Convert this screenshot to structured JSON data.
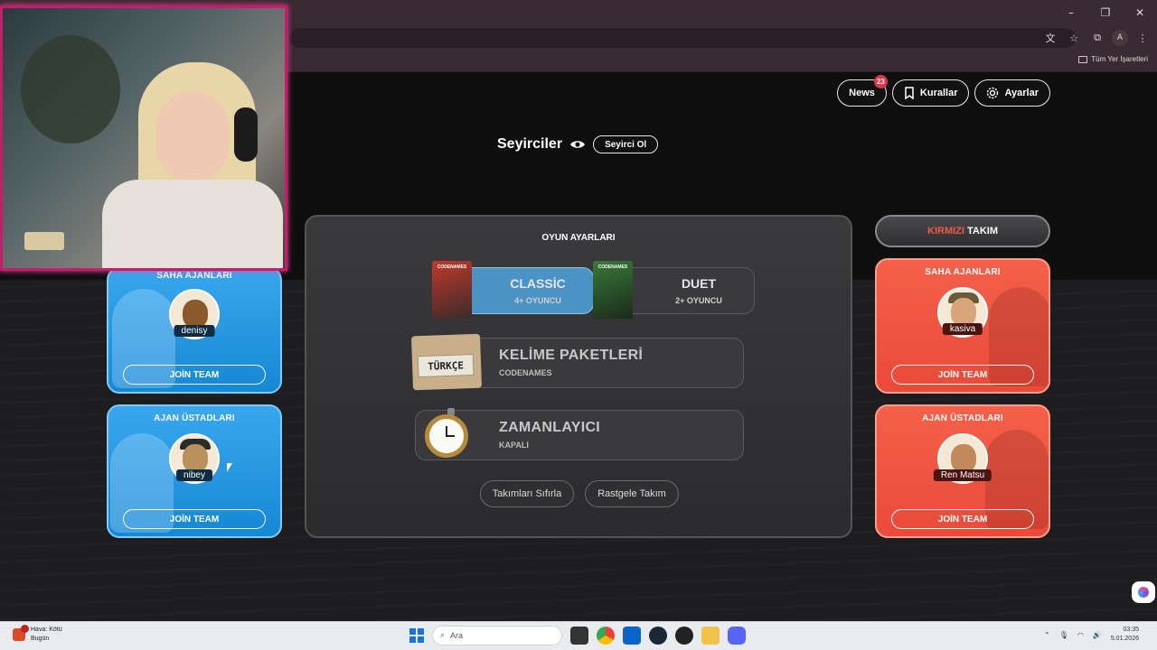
{
  "browser": {
    "window_controls": [
      "–",
      "❐",
      "✕"
    ],
    "profile_initial": "A",
    "bookmarks_all_label": "Tüm Yer İşaretleri"
  },
  "nav": {
    "news_label": "News",
    "news_badge": "23",
    "rules_label": "Kurallar",
    "settings_label": "Ayarlar"
  },
  "spectators": {
    "title": "Seyirciler",
    "button": "Seyirci Ol"
  },
  "blue_team": {
    "field_agents": {
      "title": "SAHA AJANLARI",
      "player": "denisy",
      "join": "JOİN TEAM"
    },
    "spymasters": {
      "title": "AJAN ÜSTADLARI",
      "player": "nibey",
      "join": "JOİN TEAM"
    },
    "color": "#1f95e0"
  },
  "red_team": {
    "header_red": "KIRMIZI",
    "header_rest": "TAKIM",
    "field_agents": {
      "title": "SAHA AJANLARI",
      "player": "kasiva",
      "join": "JOİN TEAM"
    },
    "spymasters": {
      "title": "AJAN ÜSTADLARI",
      "player": "Ren Matsu",
      "join": "JOİN TEAM"
    },
    "color": "#ee5440"
  },
  "settings": {
    "title": "OYUN AYARLARI",
    "modes": [
      {
        "name": "CLASSİC",
        "sub": "4+ OYUNCU",
        "box": "CODENAMES",
        "selected": true
      },
      {
        "name": "DUET",
        "sub": "2+ OYUNCU",
        "box": "CODENAMES",
        "selected": false
      }
    ],
    "word_packs": {
      "title": "KELİME PAKETLERİ",
      "sub": "CODENAMES",
      "card": "TÜRKÇE"
    },
    "timer": {
      "title": "ZAMANLAYICI",
      "sub": "KAPALI"
    },
    "reset_teams": "Takımları Sıfırla",
    "random_team": "Rastgele Takım"
  },
  "taskbar": {
    "weather_line1": "Hava: Kötü",
    "weather_line2": "Bugün",
    "search_placeholder": "Ara",
    "time": "03:35",
    "date": "5.01.2026"
  }
}
